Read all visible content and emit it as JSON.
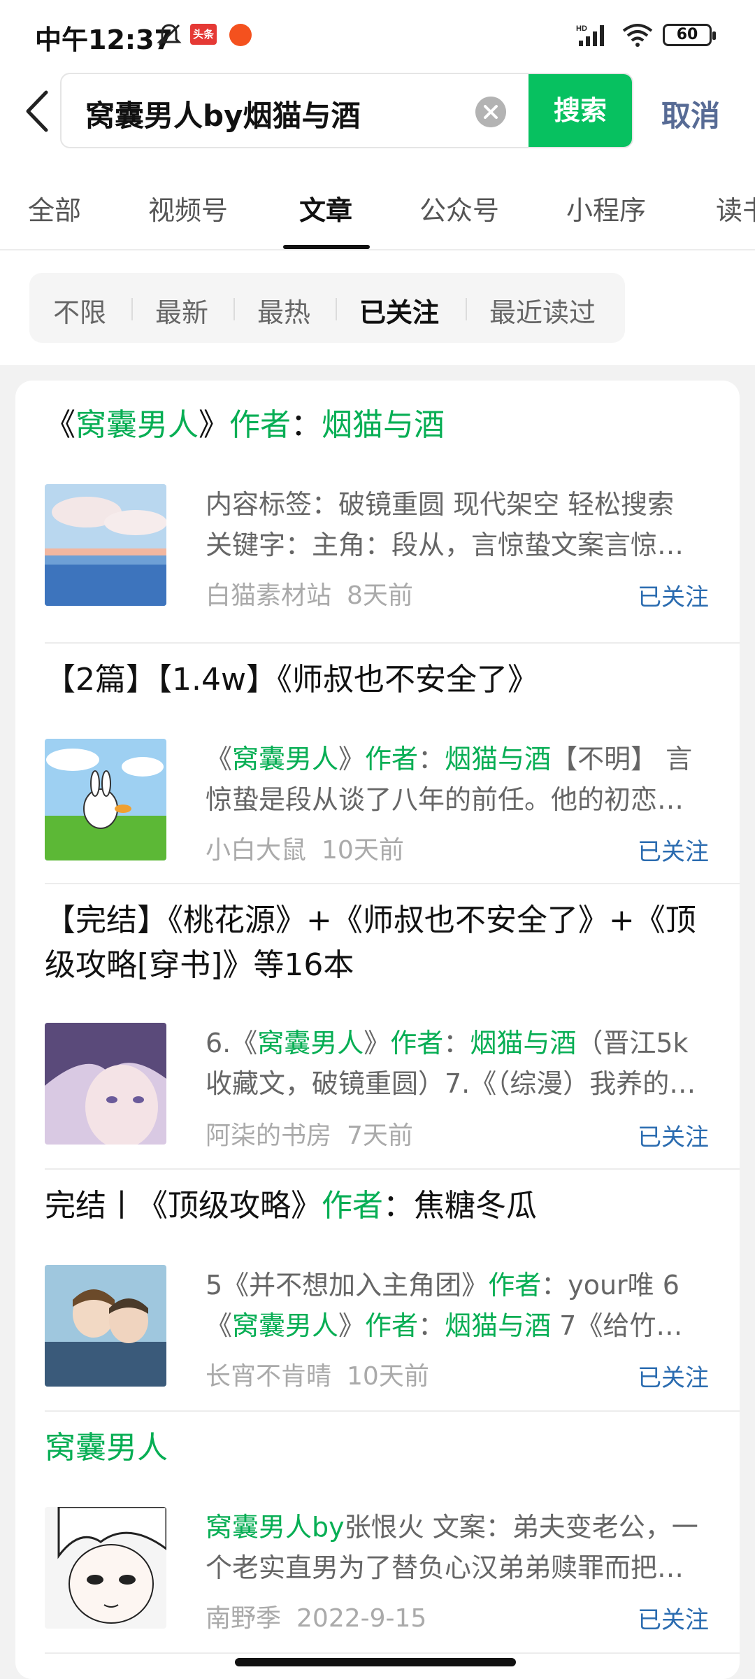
{
  "status_bar": {
    "time": "中午12:37",
    "app_badge": "头条",
    "battery": "60"
  },
  "search": {
    "query": "窝囊男人by烟猫与酒",
    "submit_label": "搜索",
    "cancel_label": "取消"
  },
  "tabs": [
    "全部",
    "视频号",
    "文章",
    "公众号",
    "小程序",
    "读书"
  ],
  "active_tab": "文章",
  "filters": [
    "不限",
    "最新",
    "最热",
    "已关注",
    "最近读过"
  ],
  "active_filter": "已关注",
  "results": [
    {
      "title": [
        "《",
        "窝囊男人",
        "》",
        "作者",
        "：",
        "烟猫与酒"
      ],
      "snippet_line1": [
        "内容标签：破镜重圆 现代架空 轻松搜索"
      ],
      "snippet_line2": [
        "关键字：主角：段从，言惊蛰文案言惊…"
      ],
      "source": "白猫素材站",
      "time": "8天前",
      "follow": "已关注"
    },
    {
      "title": [
        "【2篇】【1.4w】《师叔也不安全了》"
      ],
      "snippet_line1": [
        "《",
        "窝囊男人",
        "》",
        "作者",
        "：",
        "烟猫与酒",
        "【不明】 言"
      ],
      "snippet_line2": [
        "惊蛰是段从谈了八年的前任。他的初恋…"
      ],
      "source": "小白大鼠",
      "time": "10天前",
      "follow": "已关注"
    },
    {
      "title_line1": "【完结】《桃花源》+《师叔也不安全了》+《顶",
      "title_line2": "级攻略[穿书]》等16本",
      "snippet_line1": [
        "6.《",
        "窝囊男人",
        "》",
        "作者",
        "：",
        "烟猫与酒",
        "（晋江5k"
      ],
      "snippet_line2": [
        "收藏文，破镜重圆）7.《（综漫）我养的…"
      ],
      "source": "阿柒的书房",
      "time": "7天前",
      "follow": "已关注"
    },
    {
      "title": [
        "完结丨《顶级攻略》",
        "作者",
        "：焦糖冬瓜"
      ],
      "snippet_line1": [
        "5《并不想加入主角团》",
        "作者",
        "：your唯 6"
      ],
      "snippet_line2": [
        "《",
        "窝囊男人",
        "》",
        "作者",
        "：",
        "烟猫与酒",
        " 7《给竹…"
      ],
      "source": "长宵不肯晴",
      "time": "10天前",
      "follow": "已关注"
    },
    {
      "title": [
        "窝囊男人"
      ],
      "snippet_line1": [
        "窝囊男人by",
        "张恨火 文案：弟夫变老公，一"
      ],
      "snippet_line2": [
        "个老实直男为了替负心汉弟弟赎罪而把…"
      ],
      "source": "南野季",
      "time": "2022-9-15",
      "follow": "已关注"
    }
  ],
  "colors": {
    "accent_green": "#07c160",
    "highlight_green": "#07ae54",
    "link_blue": "#2b6cb0",
    "cancel_blue": "#576b95"
  }
}
